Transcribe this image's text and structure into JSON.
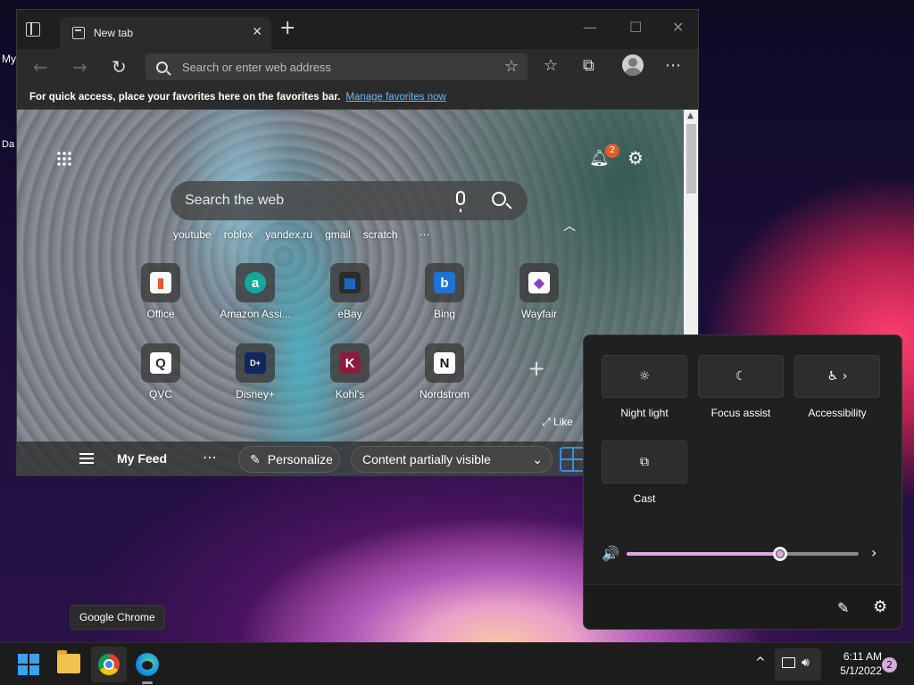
{
  "desktop": {
    "icon_fragment_1": "My",
    "icon_fragment_2": "Da"
  },
  "browser": {
    "tab": {
      "title": "New tab",
      "close": "✕"
    },
    "new_tab_symbol": "+",
    "window_controls": {
      "minimize": "—",
      "maximize": "☐",
      "close": "✕"
    },
    "toolbar": {
      "back_symbol": "←",
      "forward_symbol": "→",
      "refresh_symbol": "↻",
      "address_placeholder": "Search or enter web address",
      "add_favorite_symbol": "☆",
      "favorites_symbol": "☆",
      "collections_symbol": "⧉",
      "more_symbol": "⋯"
    },
    "favbar": {
      "message": "For quick access, place your favorites here on the favorites bar.",
      "link": "Manage favorites now"
    },
    "newtab": {
      "notification_count": "2",
      "search_placeholder": "Search the web",
      "quick_links": [
        "youtube",
        "roblox",
        "yandex.ru",
        "gmail",
        "scratch",
        "⋯"
      ],
      "tiles": [
        {
          "label": "Office",
          "glyph": "▮",
          "fg": "#e85a2a",
          "bg": "#ffffff"
        },
        {
          "label": "Amazon Assi...",
          "glyph": "a",
          "fg": "#ffffff",
          "bg": "#12a89a"
        },
        {
          "label": "eBay",
          "glyph": "▦",
          "fg": "#1f6fd1",
          "bg": "#2b2b2b"
        },
        {
          "label": "Bing",
          "glyph": "b",
          "fg": "#ffffff",
          "bg": "#1b74d8"
        },
        {
          "label": "Wayfair",
          "glyph": "◆",
          "fg": "#8b3cc4",
          "bg": "#ffffff"
        },
        {
          "label": "QVC",
          "glyph": "Q",
          "fg": "#2b2b2b",
          "bg": "#ffffff"
        },
        {
          "label": "Disney+",
          "glyph": "D+",
          "fg": "#ffffff",
          "bg": "#10285e"
        },
        {
          "label": "Kohl's",
          "glyph": "K",
          "fg": "#ffffff",
          "bg": "#8a1c3c"
        },
        {
          "label": "Nordstrom",
          "glyph": "N",
          "fg": "#111111",
          "bg": "#ffffff"
        }
      ],
      "add_tile_symbol": "+",
      "like_label": "Like",
      "feed": {
        "title": "My Feed",
        "more": "⋯",
        "personalize": "Personalize",
        "visibility": "Content partially visible"
      }
    }
  },
  "quick_settings": {
    "tiles": [
      {
        "label": "Night light",
        "glyph": "☼"
      },
      {
        "label": "Focus assist",
        "glyph": "☾"
      },
      {
        "label": "Accessibility",
        "glyph": "♿ ›"
      },
      {
        "label": "Cast",
        "glyph": "⧉"
      }
    ],
    "volume_percent": 66,
    "volume_symbol": "🔊",
    "volume_more": "›",
    "edit_symbol": "✎",
    "settings_symbol": "⚙"
  },
  "tooltip": "Google Chrome",
  "taskbar": {
    "time": "6:11 AM",
    "date": "5/1/2022",
    "notification_count": "2",
    "overflow_symbol": "^"
  },
  "colors": {
    "accent": "#3a8ee6",
    "volume_accent": "#d9a9dc",
    "notification_badge": "#e45b2a"
  }
}
